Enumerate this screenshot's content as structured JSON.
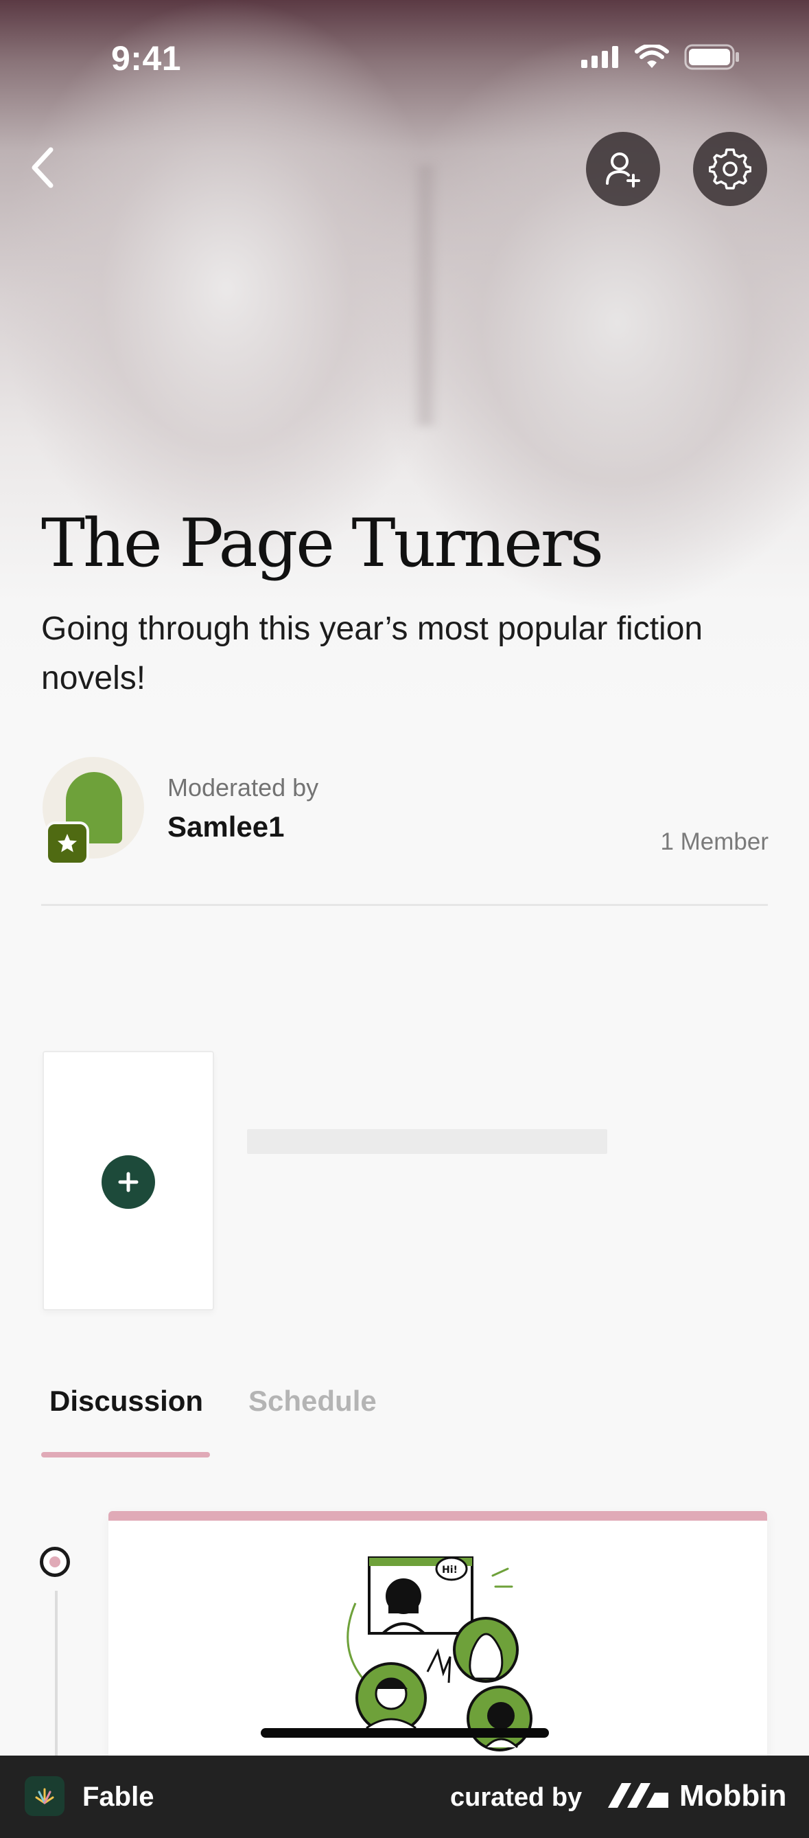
{
  "status_bar": {
    "time": "9:41"
  },
  "header": {
    "back_icon": "chevron-left-icon",
    "invite_icon": "person-add-icon",
    "settings_icon": "gear-icon"
  },
  "club": {
    "title": "The Page Turners",
    "description": "Going through this year’s most popular fiction novels!",
    "moderated_label": "Moderated by",
    "moderator_name": "Samlee1",
    "member_count": "1 Member"
  },
  "current_book": {
    "add_icon": "plus-icon"
  },
  "tabs": [
    {
      "label": "Discussion",
      "active": true
    },
    {
      "label": "Schedule",
      "active": false
    }
  ],
  "colors": {
    "accent_pink": "#e0aab7",
    "brand_green": "#1d4a3a",
    "avatar_green": "#6ea13a",
    "footer_bg": "#222222"
  },
  "footer": {
    "app_name": "Fable",
    "curated_label": "curated by",
    "brand": "Mobbin"
  }
}
